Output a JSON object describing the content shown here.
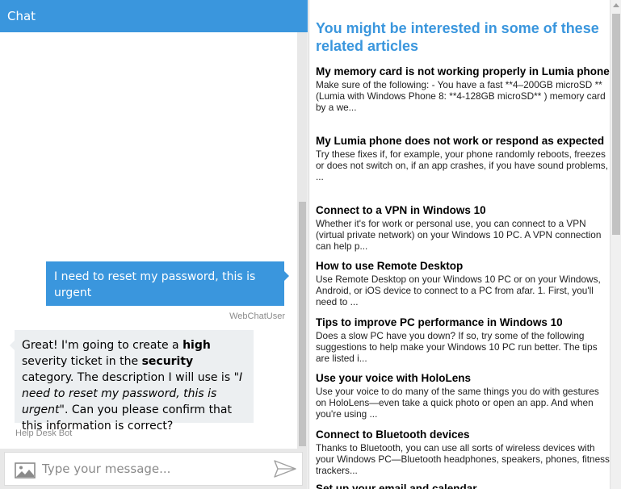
{
  "chat": {
    "title": "Chat",
    "messages": [
      {
        "role": "user",
        "text": "I need to reset my password, this is urgent",
        "from": "WebChatUser"
      },
      {
        "role": "bot",
        "from": "Help Desk Bot",
        "parts": [
          {
            "text": "Great! I'm going to create a "
          },
          {
            "text": "high",
            "style": "bold"
          },
          {
            "text": " severity ticket in the "
          },
          {
            "text": "security",
            "style": "bold"
          },
          {
            "text": " category. The description I will use is "
          },
          {
            "text": "\"I need to reset my password, this is urgent\"",
            "style": "italic"
          },
          {
            "text": ". Can you please confirm that this information is correct?"
          }
        ]
      }
    ],
    "input": {
      "placeholder": "Type your message...",
      "value": ""
    },
    "icons": {
      "upload": "image-upload-icon",
      "send": "send-icon"
    }
  },
  "articles": {
    "heading": "You might be interested in some of these related articles",
    "items": [
      {
        "title": "My memory card is not working properly in Lumia phone",
        "desc": "Make sure of the following: - You have a fast **4–200GB microSD ** (Lumia with Windows Phone 8: **4-128GB microSD** ) memory card by a we..."
      },
      {
        "title": "My Lumia phone does not work or respond as expected",
        "desc": "Try these fixes if, for example, your phone randomly reboots, freezes or does not switch on, if an app crashes, if you have sound problems, ..."
      },
      {
        "title": "Connect to a VPN in Windows 10",
        "desc": "Whether it's for work or personal use, you can connect to a VPN (virtual private network) on your Windows 10 PC. A VPN connection can help p..."
      },
      {
        "title": "How to use Remote Desktop",
        "desc": "Use Remote Desktop on your Windows 10 PC or on your Windows, Android, or iOS device to connect to a PC from afar. 1. First, you'll need to ..."
      },
      {
        "title": "Tips to improve PC performance in Windows 10",
        "desc": "Does a slow PC have you down? If so, try some of the following suggestions to help make your Windows 10 PC run better. The tips are listed i..."
      },
      {
        "title": "Use your voice with HoloLens",
        "desc": "Use your voice to do many of the same things you do with gestures on HoloLens—even take a quick photo or open an app. And when you're using ..."
      },
      {
        "title": "Connect to Bluetooth devices",
        "desc": "Thanks to Bluetooth, you can use all sorts of wireless devices with your Windows PC—Bluetooth headphones, speakers, phones, fitness trackers..."
      },
      {
        "title": "Set up your email and calendar",
        "desc": ""
      }
    ]
  },
  "colors": {
    "accent": "#3a96dd",
    "bot_bubble": "#eceff1"
  }
}
